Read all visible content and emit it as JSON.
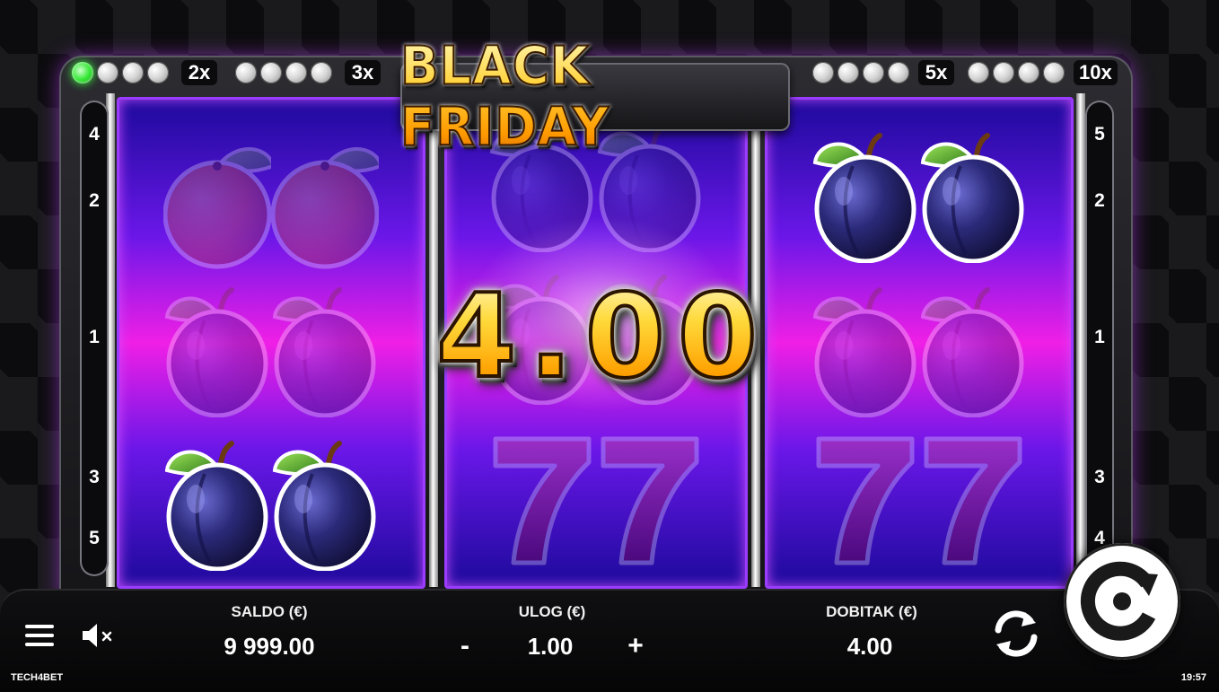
{
  "title": "BLACK FRIDAY",
  "win_display": "4.00",
  "multipliers": [
    {
      "label": "2x",
      "lights_total": 4,
      "lights_lit": 1
    },
    {
      "label": "3x",
      "lights_total": 4,
      "lights_lit": 0
    },
    {
      "label": "5x",
      "lights_total": 4,
      "lights_lit": 0
    },
    {
      "label": "10x",
      "lights_total": 4,
      "lights_lit": 0
    }
  ],
  "paylines_left": [
    "4",
    "2",
    "1",
    "3",
    "5"
  ],
  "paylines_right": [
    "5",
    "2",
    "1",
    "3",
    "4"
  ],
  "reels": [
    {
      "symbols": [
        {
          "icon": "orange-icon",
          "highlighted": false
        },
        {
          "icon": "plum-icon",
          "highlighted": false
        },
        {
          "icon": "plum-icon",
          "highlighted": true
        }
      ]
    },
    {
      "symbols": [
        {
          "icon": "plum-icon",
          "highlighted": false
        },
        {
          "icon": "plum-icon",
          "highlighted": false
        },
        {
          "icon": "seven-icon",
          "highlighted": false
        }
      ]
    },
    {
      "symbols": [
        {
          "icon": "plum-icon",
          "highlighted": true
        },
        {
          "icon": "plum-icon",
          "highlighted": false
        },
        {
          "icon": "seven-icon",
          "highlighted": false
        }
      ]
    }
  ],
  "bottom_bar": {
    "balance_label": "SALDO (€)",
    "balance_value": "9 999.00",
    "bet_label": "ULOG (€)",
    "bet_value": "1.00",
    "bet_minus": "-",
    "bet_plus": "+",
    "win_label": "DOBITAK (€)",
    "win_value": "4.00"
  },
  "footer": {
    "brand": "TECH4BET",
    "clock": "19:57"
  },
  "colors": {
    "reel_top": "#1d0a9c",
    "reel_mid": "#f01fe6",
    "gold": "#ffc21a",
    "active_light": "#35e835"
  }
}
